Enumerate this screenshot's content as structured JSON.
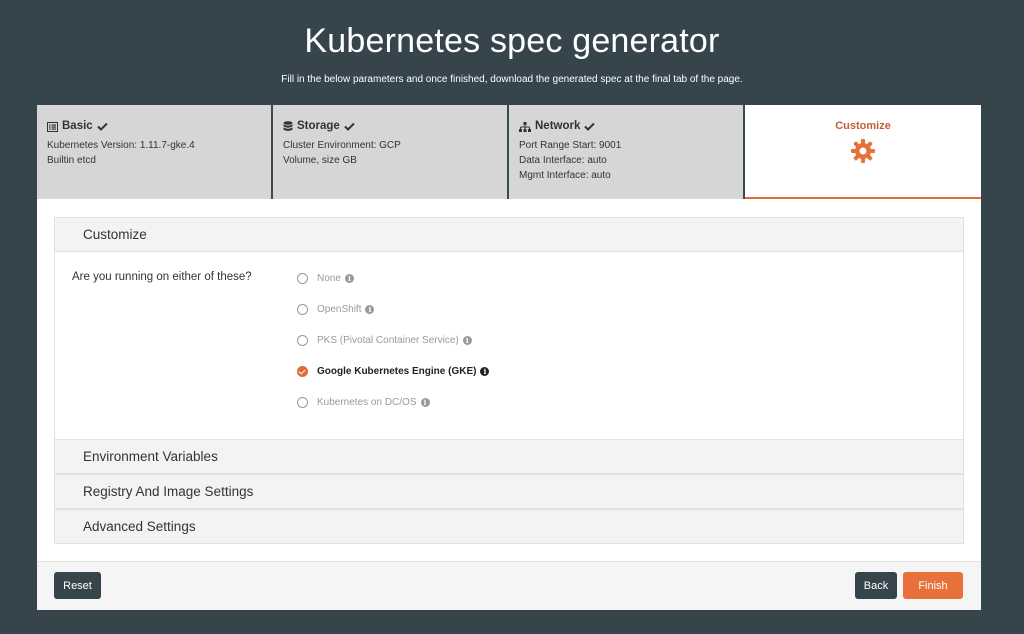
{
  "page": {
    "title": "Kubernetes spec generator",
    "subtitle": "Fill in the below parameters and once finished, download the generated spec at the final tab of the page."
  },
  "steps": [
    {
      "label": "Basic",
      "icon": "list-icon",
      "lines": [
        "Kubernetes Version: 1.11.7-gke.4",
        "Builtin etcd"
      ]
    },
    {
      "label": "Storage",
      "icon": "database-icon",
      "lines": [
        "Cluster Environment: GCP",
        "Volume, size GB"
      ]
    },
    {
      "label": "Network",
      "icon": "sitemap-icon",
      "lines": [
        "Port Range Start: 9001",
        "Data Interface: auto",
        "Mgmt Interface: auto"
      ]
    },
    {
      "label": "Customize",
      "icon": "gear-icon",
      "lines": []
    }
  ],
  "customize": {
    "header": "Customize",
    "question": "Are you running on either of these?",
    "options": [
      {
        "label": "None",
        "selected": false
      },
      {
        "label": "OpenShift",
        "selected": false
      },
      {
        "label": "PKS (Pivotal Container Service)",
        "selected": false
      },
      {
        "label": "Google Kubernetes Engine (GKE)",
        "selected": true
      },
      {
        "label": "Kubernetes on DC/OS",
        "selected": false
      }
    ]
  },
  "sections": {
    "env": "Environment Variables",
    "registry": "Registry And Image Settings",
    "advanced": "Advanced Settings"
  },
  "buttons": {
    "reset": "Reset",
    "back": "Back",
    "finish": "Finish"
  },
  "colors": {
    "background": "#36454c",
    "accent": "#e8703a"
  }
}
